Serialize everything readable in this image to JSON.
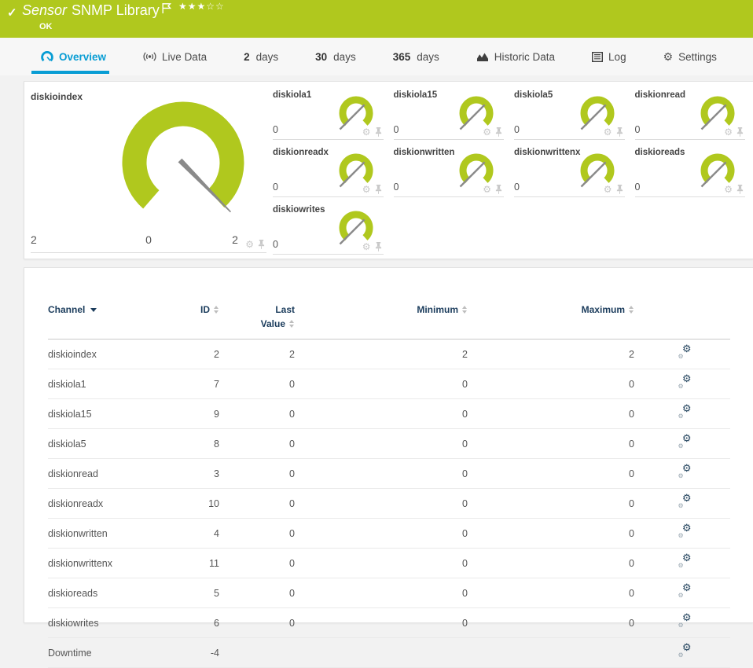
{
  "header": {
    "kind": "Sensor",
    "name": "SNMP Library",
    "status": "OK",
    "stars_filled": "★★★",
    "stars_empty": "☆☆",
    "accent_color": "#b0c81e"
  },
  "tabs": [
    {
      "icon": "gauge",
      "label": "Overview",
      "active": true
    },
    {
      "icon": "broadcast",
      "label": "Live Data"
    },
    {
      "bold": "2",
      "label": "days"
    },
    {
      "bold": "30",
      "label": "days"
    },
    {
      "bold": "365",
      "label": "days"
    },
    {
      "icon": "chart",
      "label": "Historic Data"
    },
    {
      "icon": "log",
      "label": "Log"
    },
    {
      "icon": "gear",
      "label": "Settings"
    }
  ],
  "gauges": {
    "main": {
      "title": "diskioindex",
      "value": "2",
      "min_label": "0",
      "max_label": "2"
    },
    "small": [
      {
        "title": "diskiola1",
        "value": "0"
      },
      {
        "title": "diskiola15",
        "value": "0"
      },
      {
        "title": "diskiola5",
        "value": "0"
      },
      {
        "title": "diskionread",
        "value": "0"
      },
      {
        "title": "diskionreadx",
        "value": "0"
      },
      {
        "title": "diskionwritten",
        "value": "0"
      },
      {
        "title": "diskionwrittenx",
        "value": "0"
      },
      {
        "title": "diskioreads",
        "value": "0"
      },
      {
        "title": "diskiowrites",
        "value": "0"
      }
    ]
  },
  "table": {
    "columns": {
      "channel": "Channel",
      "id": "ID",
      "last_line1": "Last",
      "last_line2": "Value",
      "min": "Minimum",
      "max": "Maximum"
    },
    "rows": [
      {
        "channel": "diskioindex",
        "id": "2",
        "last": "2",
        "min": "2",
        "max": "2"
      },
      {
        "channel": "diskiola1",
        "id": "7",
        "last": "0",
        "min": "0",
        "max": "0"
      },
      {
        "channel": "diskiola15",
        "id": "9",
        "last": "0",
        "min": "0",
        "max": "0"
      },
      {
        "channel": "diskiola5",
        "id": "8",
        "last": "0",
        "min": "0",
        "max": "0"
      },
      {
        "channel": "diskionread",
        "id": "3",
        "last": "0",
        "min": "0",
        "max": "0"
      },
      {
        "channel": "diskionreadx",
        "id": "10",
        "last": "0",
        "min": "0",
        "max": "0"
      },
      {
        "channel": "diskionwritten",
        "id": "4",
        "last": "0",
        "min": "0",
        "max": "0"
      },
      {
        "channel": "diskionwrittenx",
        "id": "11",
        "last": "0",
        "min": "0",
        "max": "0"
      },
      {
        "channel": "diskioreads",
        "id": "5",
        "last": "0",
        "min": "0",
        "max": "0"
      },
      {
        "channel": "diskiowrites",
        "id": "6",
        "last": "0",
        "min": "0",
        "max": "0"
      },
      {
        "channel": "Downtime",
        "id": "-4",
        "last": "",
        "min": "",
        "max": ""
      }
    ]
  }
}
